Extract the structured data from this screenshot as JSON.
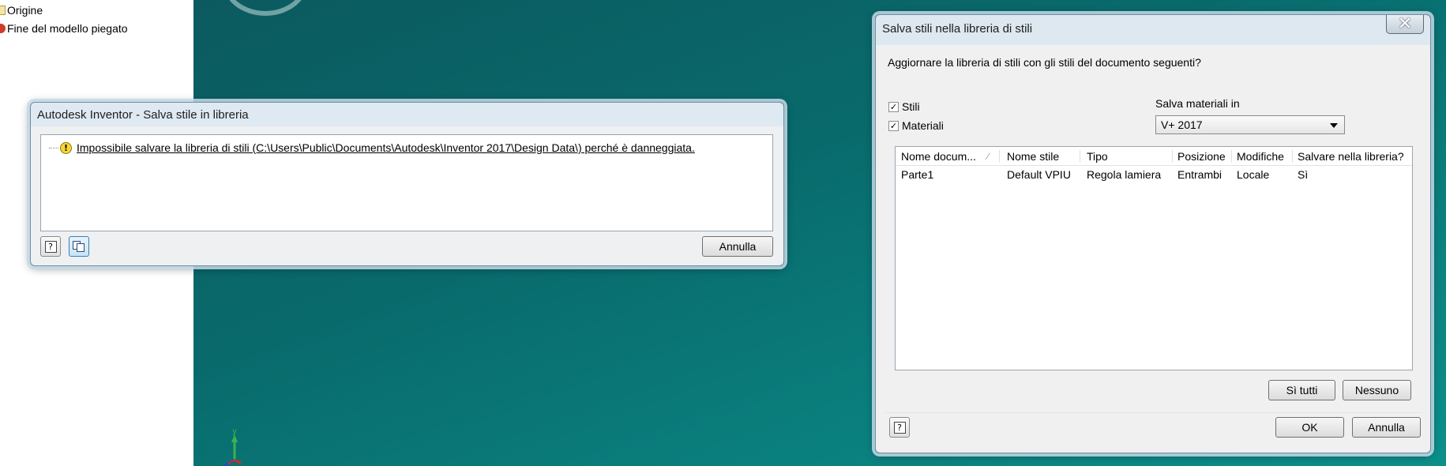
{
  "browser": {
    "items": [
      {
        "label": "Origine",
        "icon": "origin-folder-icon"
      },
      {
        "label": "Fine del modello piegato",
        "icon": "end-of-folded-model-icon"
      }
    ]
  },
  "error_dialog": {
    "title": "Autodesk Inventor - Salva stile in libreria",
    "message": "Impossibile salvare la libreria di stili (C:\\Users\\Public\\Documents\\Autodesk\\Inventor 2017\\Design Data\\) perché è danneggiata.",
    "help_icon_glyph": "?",
    "cancel_label": "Annulla"
  },
  "save_dialog": {
    "title": "Salva stili nella libreria di stili",
    "close_glyph": "✕",
    "question": "Aggiornare la libreria di stili con gli stili del documento seguenti?",
    "checkboxes": [
      {
        "label": "Stili",
        "checked": true,
        "mark": "✓"
      },
      {
        "label": "Materiali",
        "checked": true,
        "mark": "✓"
      }
    ],
    "save_materials_label": "Salva materiali in",
    "save_materials_value": "V+ 2017",
    "table": {
      "headers": [
        "Nome docum...",
        "Nome stile",
        "Tipo",
        "Posizione",
        "Modifiche",
        "Salvare nella libreria?"
      ],
      "sort_indicator": "∕",
      "rows": [
        [
          "Parte1",
          "Default VPIU",
          "Regola lamiera",
          "Entrambi",
          "Locale",
          "Sì"
        ]
      ]
    },
    "yes_all_label": "Sì tutti",
    "none_label": "Nessuno",
    "help_icon_glyph": "?",
    "ok_label": "OK",
    "cancel_label": "Annulla"
  },
  "colors": {
    "viewport_top": "#0b5a5f",
    "viewport_bottom": "#0c8f8b",
    "dialog_bg": "#f0f0f0"
  }
}
